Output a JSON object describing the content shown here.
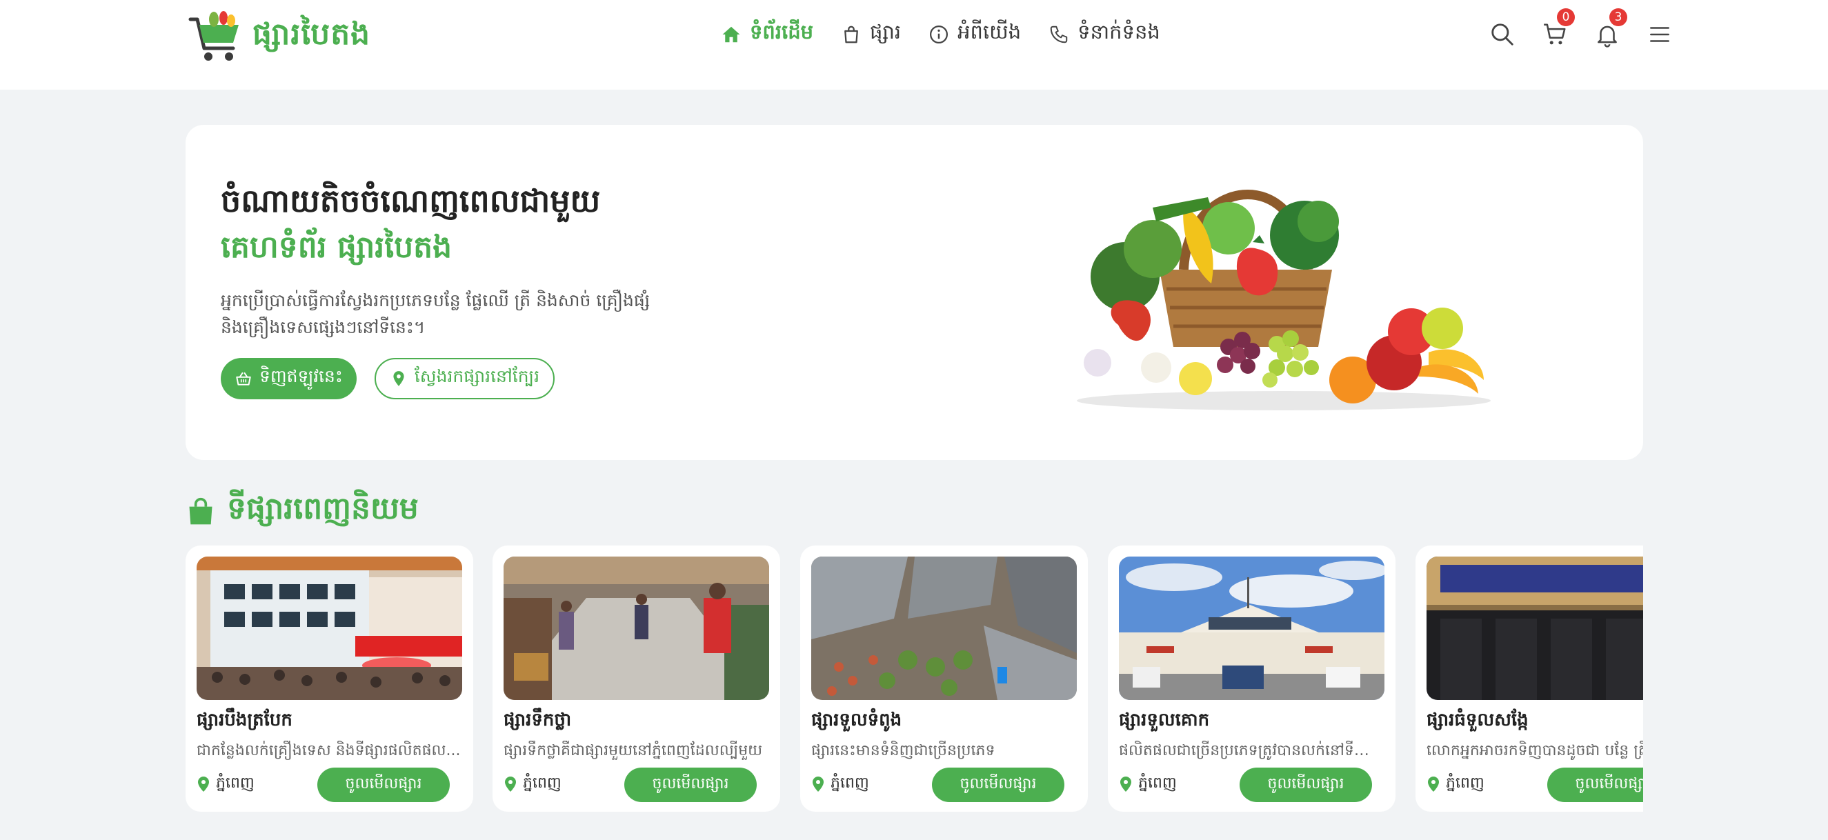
{
  "brand": {
    "name": "ផ្សារបៃតង",
    "accent": "#4caf50"
  },
  "nav": [
    {
      "label": "ទំព័រដើម",
      "icon": "home-icon",
      "active": true
    },
    {
      "label": "ផ្សារ",
      "icon": "bag-icon",
      "active": false
    },
    {
      "label": "អំពីយើង",
      "icon": "info-icon",
      "active": false
    },
    {
      "label": "ទំនាក់ទំនង",
      "icon": "phone-icon",
      "active": false
    }
  ],
  "tools": {
    "cart_count": "0",
    "notification_count": "3"
  },
  "hero": {
    "title": "ចំណាយតិចចំណេញពេលជាមួយ",
    "subtitle": "គេហទំព័រ ផ្សារបៃតង",
    "desc_line1": "អ្នកប្រើប្រាស់ធ្វើការស្វែងរកប្រភេទបន្លែ ផ្លែឈើ ត្រី និងសាច់ គ្រឿងផ្សំ",
    "desc_line2": "និងគ្រឿងទេសផ្សេងៗនៅទីនេះ។",
    "buy_label": "ទិញឥឡូវនេះ",
    "find_label": "ស្វែងរកផ្សារនៅក្បែរ"
  },
  "section": {
    "title": "ទីផ្សារពេញនិយម"
  },
  "markets": [
    {
      "name": "ផ្សារបឹងត្របែក",
      "desc": "ជាកន្លែងលក់គ្រឿងទេស និងទីផ្សារផលិតផល...",
      "location": "ភ្នំពេញ",
      "button": "ចូលមើលផ្សារ"
    },
    {
      "name": "ផ្សារទឹកថ្លា",
      "desc": "ផ្សារទឹកថ្លាគឺជាផ្សារមួយនៅភ្នំពេញដែលល្បីមួយ",
      "location": "ភ្នំពេញ",
      "button": "ចូលមើលផ្សារ"
    },
    {
      "name": "ផ្សារទួលទំពូង",
      "desc": "ផ្សារនេះមានទំនិញជាច្រើនប្រភេទ",
      "location": "ភ្នំពេញ",
      "button": "ចូលមើលផ្សារ"
    },
    {
      "name": "ផ្សារទួលគោក",
      "desc": "ផលិតផលជាច្រើនប្រភេទត្រូវបានលក់នៅទីនេះ។",
      "location": "ភ្នំពេញ",
      "button": "ចូលមើលផ្សារ"
    },
    {
      "name": "ផ្សារធំទួលសង្កែ",
      "desc": "លោកអ្នកអាចរកទិញបានដូចជា បន្លែ ត្រី",
      "location": "ភ្នំពេញ",
      "button": "ចូលមើលផ្សារ"
    }
  ]
}
